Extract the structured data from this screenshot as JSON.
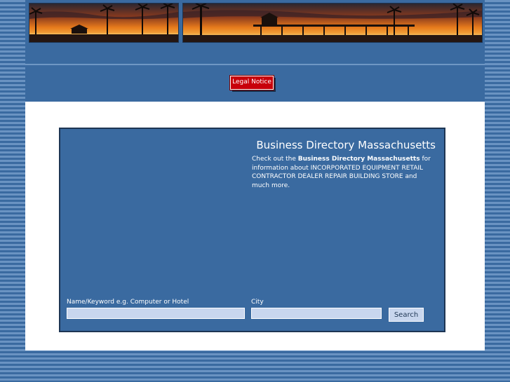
{
  "header": {
    "legal_notice_label": "Legal Notice"
  },
  "directory": {
    "title": "Business Directory Massachusetts",
    "intro_prefix": "Check out the ",
    "intro_bold": "Business Directory Massachusetts",
    "intro_suffix": " for information about INCORPORATED EQUIPMENT RETAIL CONTRACTOR DEALER REPAIR BUILDING STORE and much more."
  },
  "search": {
    "keyword_label": "Name/Keyword e.g. Computer or Hotel",
    "keyword_value": "",
    "city_label": "City",
    "city_value": "",
    "button_label": "Search"
  },
  "colors": {
    "background_blue": "#3a6aa0",
    "stripe_light": "#6a93c2",
    "legal_red": "#c8000a",
    "input_fill": "#c8d6ee"
  }
}
